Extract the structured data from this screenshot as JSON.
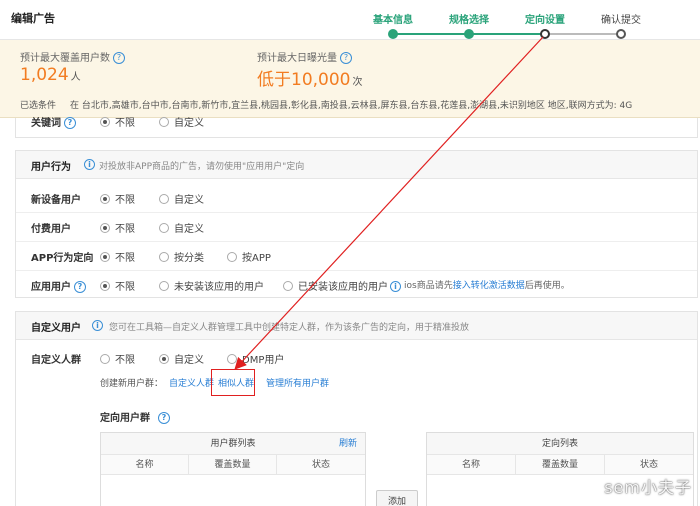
{
  "header": {
    "title": "编辑广告",
    "steps": [
      {
        "label": "基本信息",
        "state": "done"
      },
      {
        "label": "规格选择",
        "state": "done"
      },
      {
        "label": "定向设置",
        "state": "current"
      },
      {
        "label": "确认提交",
        "state": "todo"
      }
    ]
  },
  "summary": {
    "users_label": "预计最大覆盖用户数",
    "users_value": "1,024",
    "users_unit": "人",
    "exposure_label": "预计最大日曝光量",
    "exposure_value": "低于10,000",
    "exposure_unit": "次",
    "conditions_label": "已选条件",
    "conditions_text": "在 台北市,高雄市,台中市,台南市,新竹市,宜兰县,桃园县,彰化县,南投县,云林县,屏东县,台东县,花莲县,澎湖县,未识别地区 地区,联网方式为: 4G"
  },
  "keyword_row": {
    "label": "关键词",
    "opt1": "不限",
    "opt2": "自定义"
  },
  "behavior": {
    "title": "用户行为",
    "hint": "对投放非APP商品的广告，请勿使用\"应用用户\"定向",
    "rows": [
      {
        "label": "新设备用户",
        "options": [
          "不限",
          "自定义"
        ]
      },
      {
        "label": "付费用户",
        "options": [
          "不限",
          "自定义"
        ]
      },
      {
        "label": "APP行为定向",
        "options": [
          "不限",
          "按分类",
          "按APP"
        ]
      },
      {
        "label": "应用用户",
        "options": [
          "不限",
          "未安装该应用的用户",
          "已安装该应用的用户"
        ]
      }
    ],
    "ios_note_pre": "ios商品请先",
    "ios_note_link": "接入转化激活数据",
    "ios_note_post": "后再使用。"
  },
  "custom": {
    "title": "自定义用户",
    "hint": "您可在工具箱—自定义人群管理工具中创建特定人群，作为该条广告的定向，用于精准投放",
    "row_label": "自定义人群",
    "options": [
      "不限",
      "自定义",
      "DMP用户"
    ],
    "create_label": "创建新用户群：",
    "link1": "自定义人群",
    "link2": "相似人群",
    "link3": "管理所有用户群",
    "targeting_title": "定向用户群",
    "left_table": {
      "title": "用户群列表",
      "refresh": "刷新",
      "cols": [
        "名称",
        "覆盖数量",
        "状态"
      ]
    },
    "right_table": {
      "title": "定向列表",
      "cols": [
        "名称",
        "覆盖数量",
        "状态"
      ]
    },
    "add_button": "添加"
  },
  "watermark": "sem小夫子",
  "colors": {
    "accent_green": "#2aa37a",
    "value_orange": "#f27c21",
    "link_blue": "#2a7fd4",
    "annotation_red": "#e02020"
  }
}
